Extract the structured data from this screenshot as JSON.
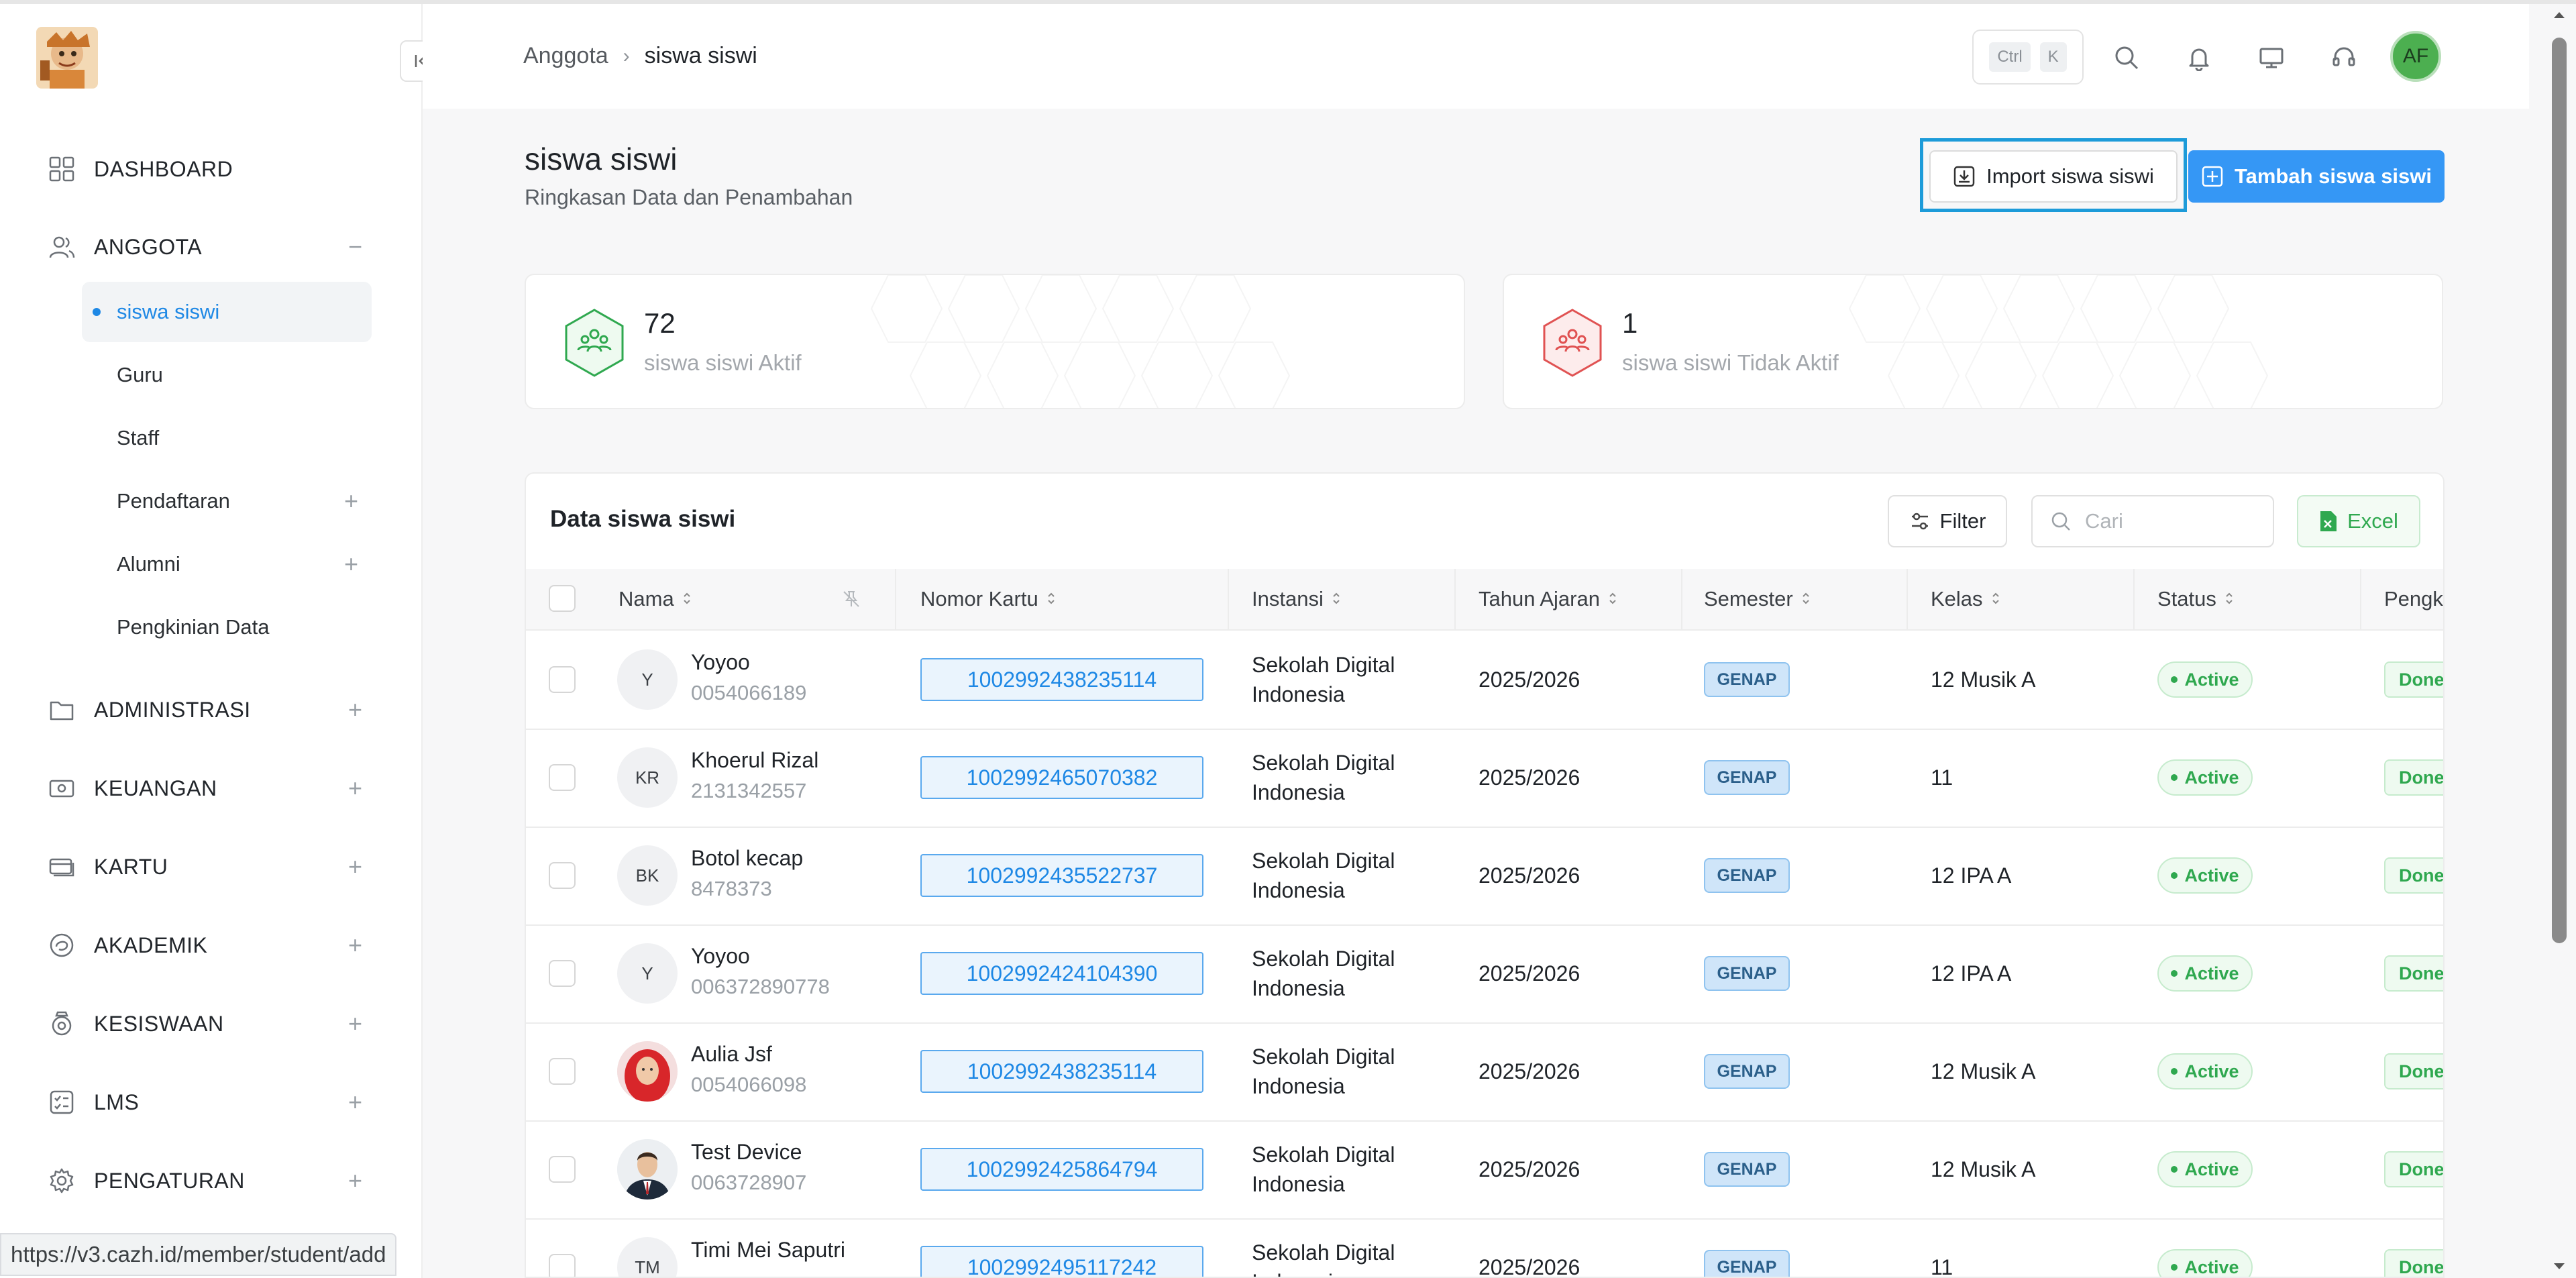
{
  "breadcrumb": {
    "parent": "Anggota",
    "current": "siswa siswi"
  },
  "header": {
    "kbd_ctrl": "Ctrl",
    "kbd_k": "K",
    "avatar": "AF"
  },
  "sidebar": {
    "items": [
      {
        "label": "DASHBOARD",
        "icon": "grid-icon"
      },
      {
        "label": "ANGGOTA",
        "icon": "users-icon",
        "toggle": "−"
      },
      {
        "label": "ADMINISTRASI",
        "icon": "folder-icon",
        "toggle": "+"
      },
      {
        "label": "KEUANGAN",
        "icon": "money-icon",
        "toggle": "+"
      },
      {
        "label": "KARTU",
        "icon": "card-icon",
        "toggle": "+"
      },
      {
        "label": "AKADEMIK",
        "icon": "academic-icon",
        "toggle": "+"
      },
      {
        "label": "KESISWAAN",
        "icon": "badge-icon",
        "toggle": "+"
      },
      {
        "label": "LMS",
        "icon": "checklist-icon",
        "toggle": "+"
      },
      {
        "label": "PENGATURAN",
        "icon": "gear-icon",
        "toggle": "+"
      }
    ],
    "sub_items": [
      {
        "label": "siswa siswi"
      },
      {
        "label": "Guru"
      },
      {
        "label": "Staff"
      },
      {
        "label": "Pendaftaran",
        "toggle": "+"
      },
      {
        "label": "Alumni",
        "toggle": "+"
      },
      {
        "label": "Pengkinian Data"
      }
    ]
  },
  "page": {
    "title": "siswa siswi",
    "subtitle": "Ringkasan Data dan Penambahan",
    "import_label": "Import siswa siswi",
    "add_label": "Tambah siswa siswi"
  },
  "stats": [
    {
      "value": "72",
      "label": "siswa siswi Aktif",
      "color": "#2fa84f"
    },
    {
      "value": "1",
      "label": "siswa siswi Tidak Aktif",
      "color": "#e05252"
    }
  ],
  "table": {
    "title": "Data siswa siswi",
    "filter_label": "Filter",
    "search_placeholder": "Cari",
    "excel_label": "Excel",
    "columns": [
      "Nama",
      "Nomor Kartu",
      "Instansi",
      "Tahun Ajaran",
      "Semester",
      "Kelas",
      "Status",
      "Pengk"
    ],
    "rows": [
      {
        "initials": "Y",
        "name": "Yoyoo",
        "id": "0054066189",
        "card": "1002992438235114",
        "inst1": "Sekolah Digital",
        "inst2": "Indonesia",
        "year": "2025/2026",
        "semester": "GENAP",
        "kelas": "12 Musik A",
        "status": "Active",
        "update": "Done"
      },
      {
        "initials": "KR",
        "name": "Khoerul Rizal",
        "id": "2131342557",
        "card": "1002992465070382",
        "inst1": "Sekolah Digital",
        "inst2": "Indonesia",
        "year": "2025/2026",
        "semester": "GENAP",
        "kelas": "11",
        "status": "Active",
        "update": "Done"
      },
      {
        "initials": "BK",
        "name": "Botol kecap",
        "id": "8478373",
        "card": "1002992435522737",
        "inst1": "Sekolah Digital",
        "inst2": "Indonesia",
        "year": "2025/2026",
        "semester": "GENAP",
        "kelas": "12 IPA A",
        "status": "Active",
        "update": "Done"
      },
      {
        "initials": "Y",
        "name": "Yoyoo",
        "id": "006372890778",
        "card": "1002992424104390",
        "inst1": "Sekolah Digital",
        "inst2": "Indonesia",
        "year": "2025/2026",
        "semester": "GENAP",
        "kelas": "12 IPA A",
        "status": "Active",
        "update": "Done"
      },
      {
        "initials": "",
        "photo": "photo-woman-hijab",
        "name": "Aulia Jsf",
        "id": "0054066098",
        "card": "1002992438235114",
        "inst1": "Sekolah Digital",
        "inst2": "Indonesia",
        "year": "2025/2026",
        "semester": "GENAP",
        "kelas": "12 Musik A",
        "status": "Active",
        "update": "Done"
      },
      {
        "initials": "",
        "photo": "photo-man-suit",
        "name": "Test Device",
        "id": "0063728907",
        "card": "1002992425864794",
        "inst1": "Sekolah Digital",
        "inst2": "Indonesia",
        "year": "2025/2026",
        "semester": "GENAP",
        "kelas": "12 Musik A",
        "status": "Active",
        "update": "Done"
      },
      {
        "initials": "TM",
        "name": "Timi Mei Saputri",
        "id": "",
        "card": "1002992495117242",
        "inst1": "Sekolah Digital",
        "inst2": "Indonesia",
        "year": "2025/2026",
        "semester": "GENAP",
        "kelas": "11",
        "status": "Active",
        "update": "Done"
      }
    ]
  },
  "status_url": "https://v3.cazh.id/member/student/add"
}
